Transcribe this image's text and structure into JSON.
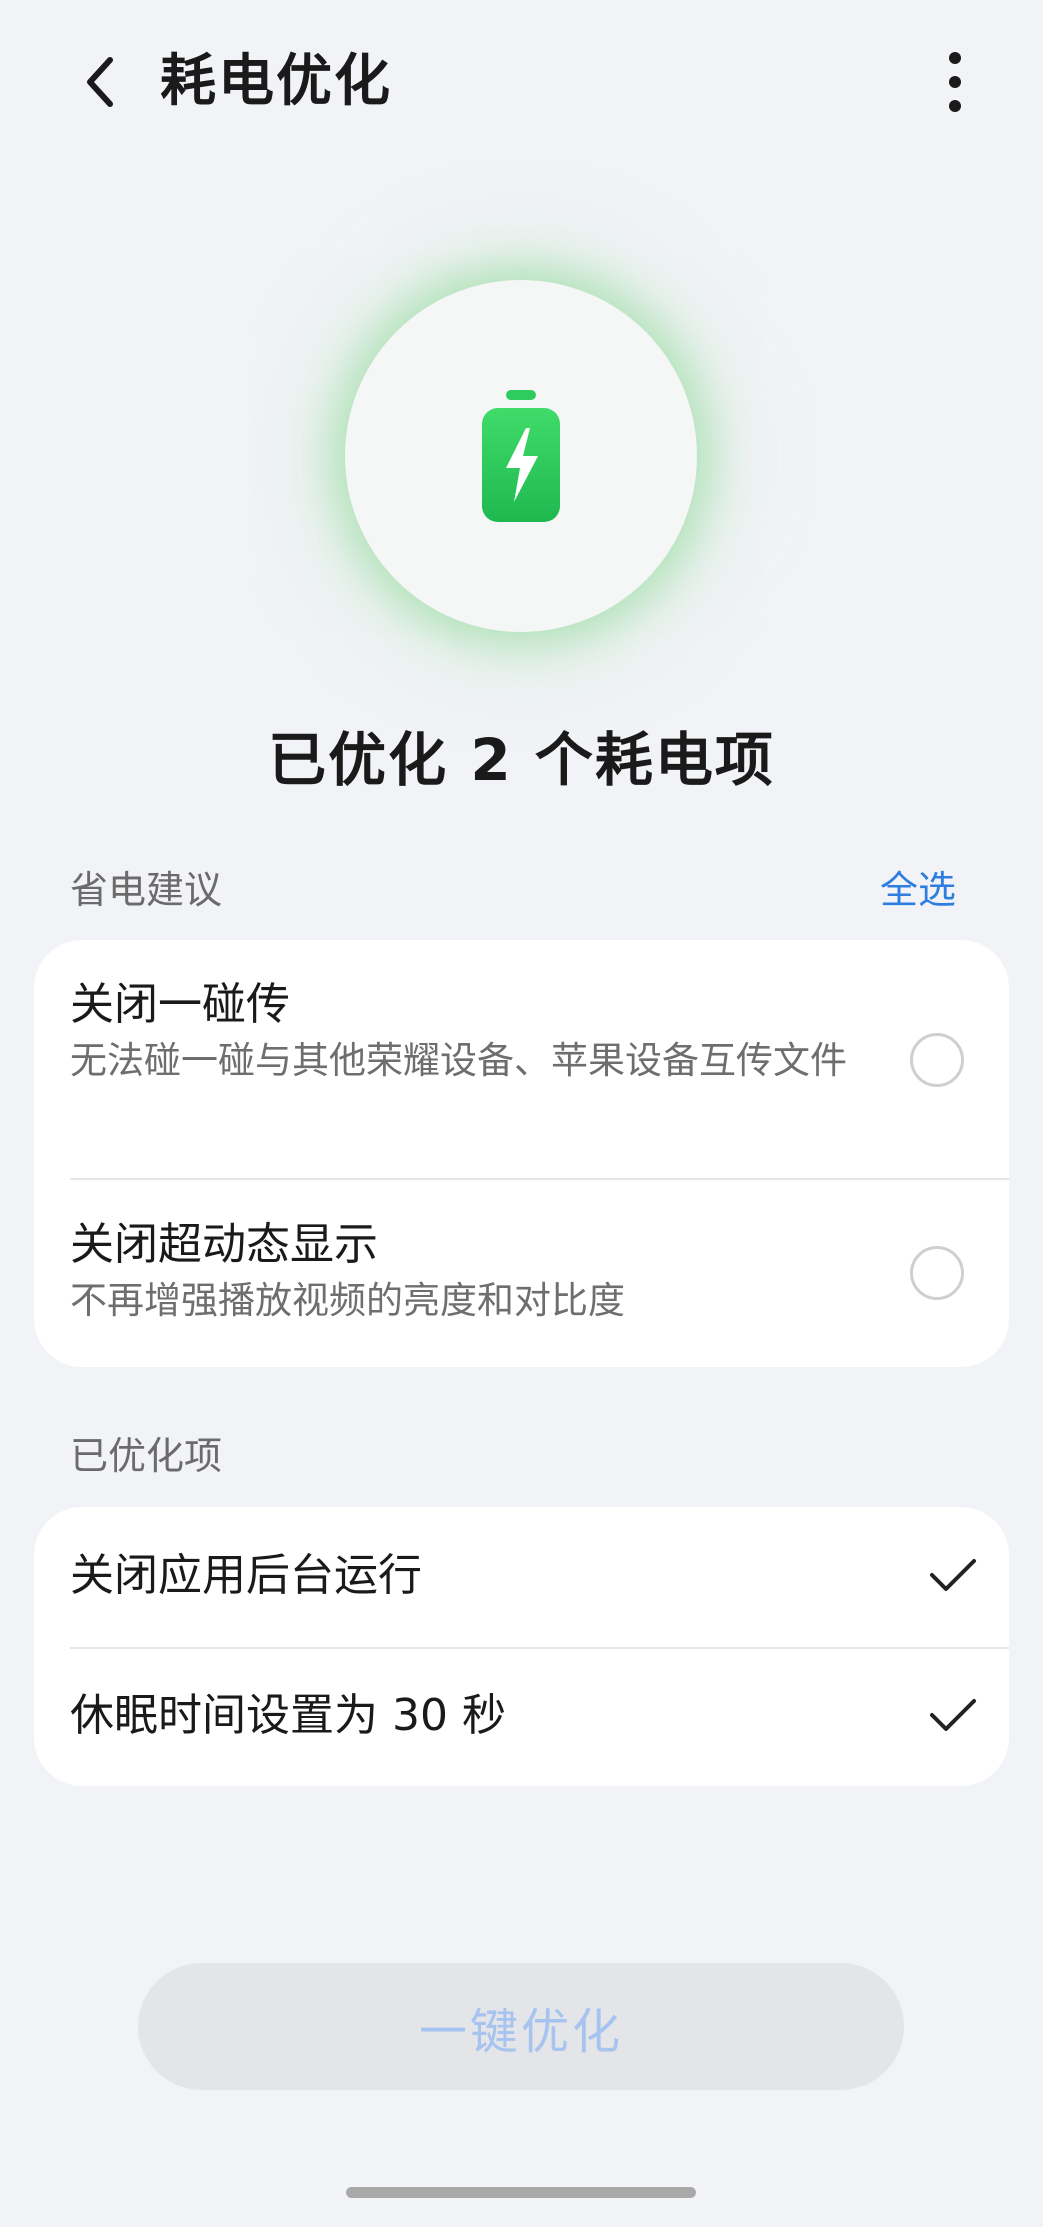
{
  "header": {
    "title": "耗电优化",
    "back_icon": "chevron-left-icon",
    "more_icon": "more-vertical-icon"
  },
  "hero": {
    "icon": "battery-charging-icon",
    "accent_color": "#22c55e"
  },
  "summary": {
    "text": "已优化 2 个耗电项"
  },
  "suggestions": {
    "label": "省电建议",
    "select_all_label": "全选",
    "items": [
      {
        "title": "关闭一碰传",
        "description": "无法碰一碰与其他荣耀设备、苹果设备互传文件",
        "selected": false
      },
      {
        "title": "关闭超动态显示",
        "description": "不再增强播放视频的亮度和对比度",
        "selected": false
      }
    ]
  },
  "optimized": {
    "label": "已优化项",
    "items": [
      {
        "title": "关闭应用后台运行",
        "status_icon": "checkmark-icon"
      },
      {
        "title": "休眠时间设置为 30 秒",
        "status_icon": "checkmark-icon"
      }
    ]
  },
  "cta": {
    "label": "一键优化",
    "enabled": false
  },
  "colors": {
    "background": "#f1f3f6",
    "link": "#2f7de1",
    "disabled_text": "#a6c4ef"
  }
}
